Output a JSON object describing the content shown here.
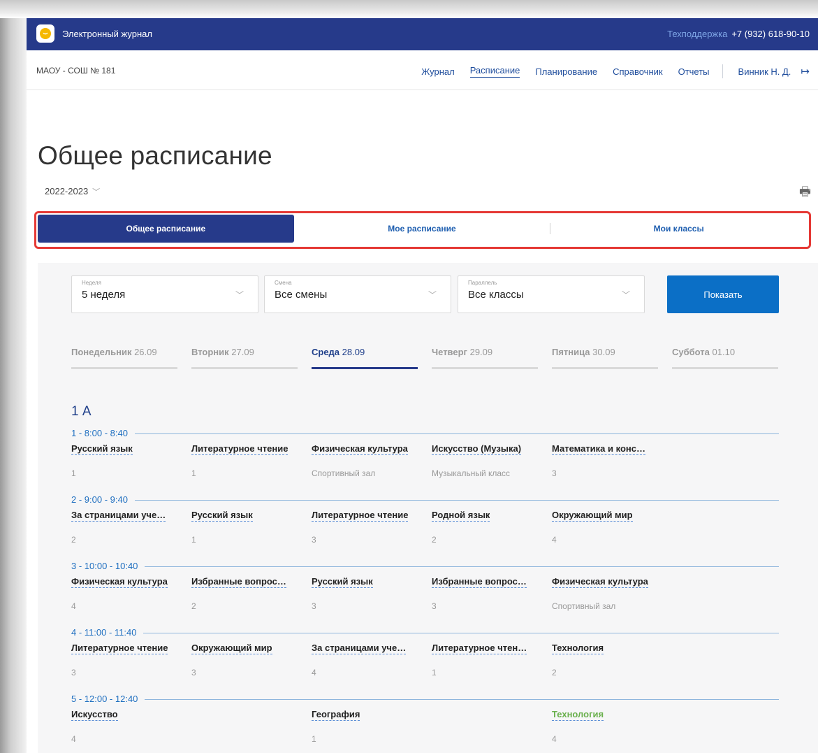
{
  "app": {
    "title": "Электронный журнал",
    "support_label": "Техподдержка",
    "phone": "+7 (932) 618-90-10"
  },
  "school": "МАОУ - СОШ № 181",
  "nav": {
    "items": [
      {
        "label": "Журнал",
        "active": false
      },
      {
        "label": "Расписание",
        "active": true
      },
      {
        "label": "Планирование",
        "active": false
      },
      {
        "label": "Справочник",
        "active": false
      },
      {
        "label": "Отчеты",
        "active": false
      }
    ],
    "user": "Винник Н. Д."
  },
  "page_title": "Общее расписание",
  "year": "2022-2023",
  "tabs": [
    {
      "label": "Общее расписание",
      "selected": true
    },
    {
      "label": "Мое расписание",
      "selected": false
    },
    {
      "label": "Мои классы",
      "selected": false
    }
  ],
  "filters": {
    "week": {
      "label": "Неделя",
      "value": "5 неделя"
    },
    "shift": {
      "label": "Смена",
      "value": "Все смены"
    },
    "parallel": {
      "label": "Параллель",
      "value": "Все классы"
    },
    "show_button": "Показать"
  },
  "days": [
    {
      "name": "Понедельник",
      "date": "26.09",
      "active": false
    },
    {
      "name": "Вторник",
      "date": "27.09",
      "active": false
    },
    {
      "name": "Среда",
      "date": "28.09",
      "active": true
    },
    {
      "name": "Четверг",
      "date": "29.09",
      "active": false
    },
    {
      "name": "Пятница",
      "date": "30.09",
      "active": false
    },
    {
      "name": "Суббота",
      "date": "01.10",
      "active": false
    }
  ],
  "class_name": "1 А",
  "lessons": [
    {
      "number": "1",
      "time": " - 8:00 - 8:40",
      "cells": [
        {
          "subject": "Русский язык",
          "room": "1"
        },
        {
          "subject": "Литературное чтение",
          "room": "1"
        },
        {
          "subject": "Физическая культура",
          "room": "Спортивный зал"
        },
        {
          "subject": "Искусство (Музыка)",
          "room": "Музыкальный класс"
        },
        {
          "subject": "Математика и конс…",
          "room": "3"
        }
      ]
    },
    {
      "number": "2",
      "time": " - 9:00 - 9:40",
      "cells": [
        {
          "subject": "За страницами уче…",
          "room": "2"
        },
        {
          "subject": "Русский язык",
          "room": "1"
        },
        {
          "subject": "Литературное чтение",
          "room": "3"
        },
        {
          "subject": "Родной язык",
          "room": "2"
        },
        {
          "subject": "Окружающий мир",
          "room": "4"
        }
      ]
    },
    {
      "number": "3",
      "time": " - 10:00 - 10:40",
      "cells": [
        {
          "subject": "Физическая культура",
          "room": "4"
        },
        {
          "subject": "Избранные вопрос…",
          "room": "2"
        },
        {
          "subject": "Русский язык",
          "room": "3"
        },
        {
          "subject": "Избранные вопрос…",
          "room": "3"
        },
        {
          "subject": "Физическая культура",
          "room": "Спортивный зал"
        }
      ]
    },
    {
      "number": "4",
      "time": " - 11:00 - 11:40",
      "cells": [
        {
          "subject": "Литературное чтение",
          "room": "3"
        },
        {
          "subject": "Окружающий мир",
          "room": "3"
        },
        {
          "subject": "За страницами уче…",
          "room": "4"
        },
        {
          "subject": "Литературное чтен…",
          "room": "1"
        },
        {
          "subject": "Технология",
          "room": "2"
        }
      ]
    },
    {
      "number": "5",
      "time": " - 12:00 - 12:40",
      "cells": [
        {
          "subject": "Искусство",
          "room": "4"
        },
        {
          "subject": "",
          "room": ""
        },
        {
          "subject": "География",
          "room": "1"
        },
        {
          "subject": "",
          "room": ""
        },
        {
          "subject": "Технология",
          "room": "4",
          "color": "#6ab04c"
        }
      ]
    }
  ]
}
